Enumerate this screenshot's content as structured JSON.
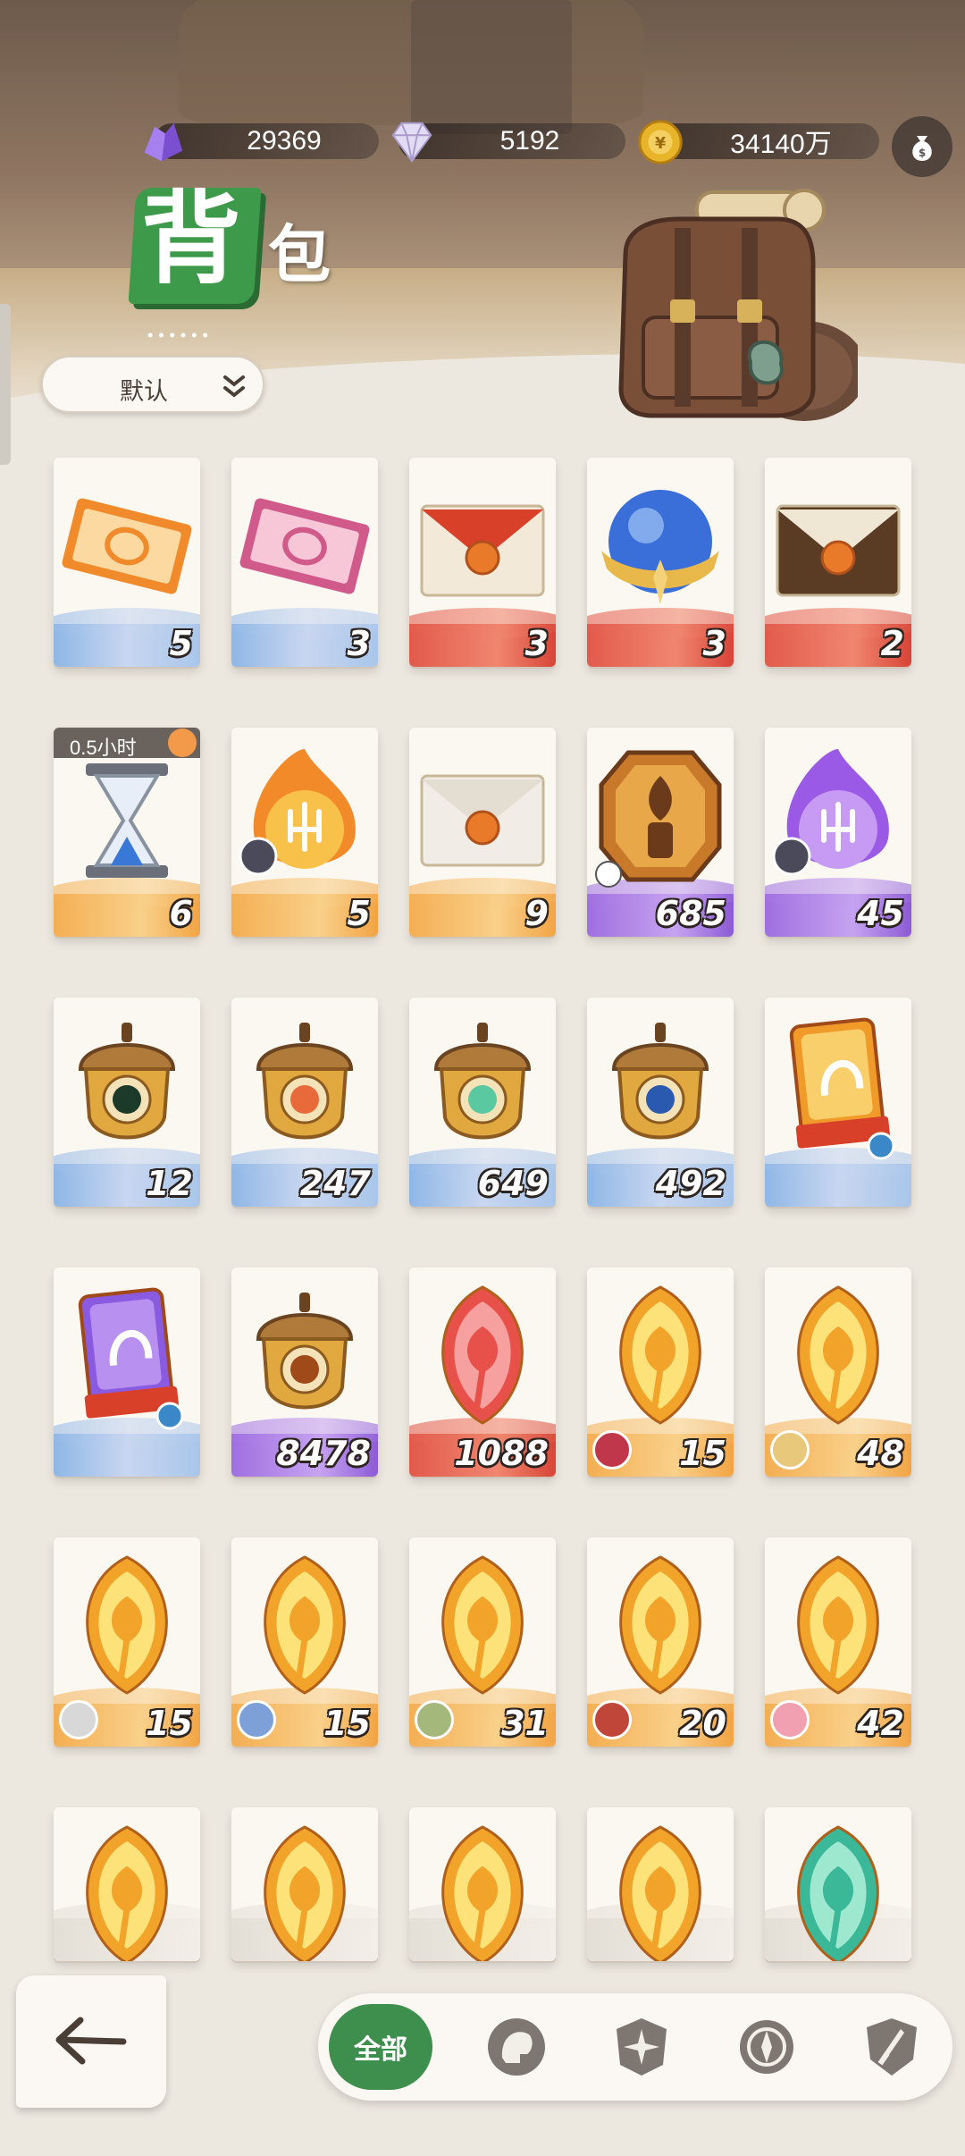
{
  "currencies": [
    {
      "name": "purple-crystal",
      "value": "29369",
      "color": "#8a5cd8"
    },
    {
      "name": "diamond",
      "value": "5192",
      "color": "#e8e2f7"
    },
    {
      "name": "gold-coin",
      "value": "34140万",
      "color": "#e8b52a"
    }
  ],
  "title": {
    "main": "背",
    "sub": "包",
    "dots": "••••••"
  },
  "sort": {
    "label": "默认"
  },
  "items": [
    {
      "id": "ticket-orange",
      "count": "5",
      "band": "blue"
    },
    {
      "id": "ticket-pink",
      "count": "3",
      "band": "blue"
    },
    {
      "id": "red-envelope",
      "count": "3",
      "band": "red"
    },
    {
      "id": "crystal-orb",
      "count": "3",
      "band": "red"
    },
    {
      "id": "brown-envelope",
      "count": "2",
      "band": "red"
    },
    {
      "id": "hourglass",
      "count": "6",
      "band": "orange",
      "timer": "0.5小时"
    },
    {
      "id": "fire-orb-fragment",
      "count": "5",
      "band": "orange"
    },
    {
      "id": "white-envelope",
      "count": "9",
      "band": "orange"
    },
    {
      "id": "torch-medal",
      "count": "685",
      "band": "purple"
    },
    {
      "id": "purple-orb-fragment",
      "count": "45",
      "band": "purple"
    },
    {
      "id": "acorn-eye",
      "count": "12",
      "band": "blue"
    },
    {
      "id": "acorn-target",
      "count": "247",
      "band": "blue"
    },
    {
      "id": "acorn-leaf",
      "count": "649",
      "band": "blue"
    },
    {
      "id": "acorn-star",
      "count": "492",
      "band": "blue"
    },
    {
      "id": "orange-card-ticket",
      "count": "",
      "band": "blue"
    },
    {
      "id": "purple-card-ticket",
      "count": "",
      "band": "blue"
    },
    {
      "id": "acorn-diamond",
      "count": "8478",
      "band": "purple"
    },
    {
      "id": "red-leaf-crystal",
      "count": "1088",
      "band": "red"
    },
    {
      "id": "gold-leaf-crystal",
      "count": "15",
      "band": "orange"
    },
    {
      "id": "gold-leaf-crystal",
      "count": "48",
      "band": "orange"
    },
    {
      "id": "gold-leaf-crystal",
      "count": "15",
      "band": "orange"
    },
    {
      "id": "gold-leaf-crystal",
      "count": "15",
      "band": "orange"
    },
    {
      "id": "gold-leaf-crystal",
      "count": "31",
      "band": "orange"
    },
    {
      "id": "gold-leaf-crystal",
      "count": "20",
      "band": "orange"
    },
    {
      "id": "gold-leaf-crystal",
      "count": "42",
      "band": "orange"
    },
    {
      "id": "gold-leaf-crystal",
      "count": "",
      "band": "gray"
    },
    {
      "id": "gold-leaf-crystal",
      "count": "",
      "band": "gray"
    },
    {
      "id": "gold-leaf-crystal",
      "count": "",
      "band": "gray"
    },
    {
      "id": "gold-leaf-crystal",
      "count": "",
      "band": "gray"
    },
    {
      "id": "green-leaf-crystal",
      "count": "",
      "band": "gray"
    }
  ],
  "tabs": {
    "all_label": "全部",
    "icons": [
      "helmet-icon",
      "star-shield-icon",
      "compass-icon",
      "sword-shield-icon"
    ]
  },
  "colors": {
    "accent": "#3e8f4e",
    "card": "#fbf8f2"
  }
}
